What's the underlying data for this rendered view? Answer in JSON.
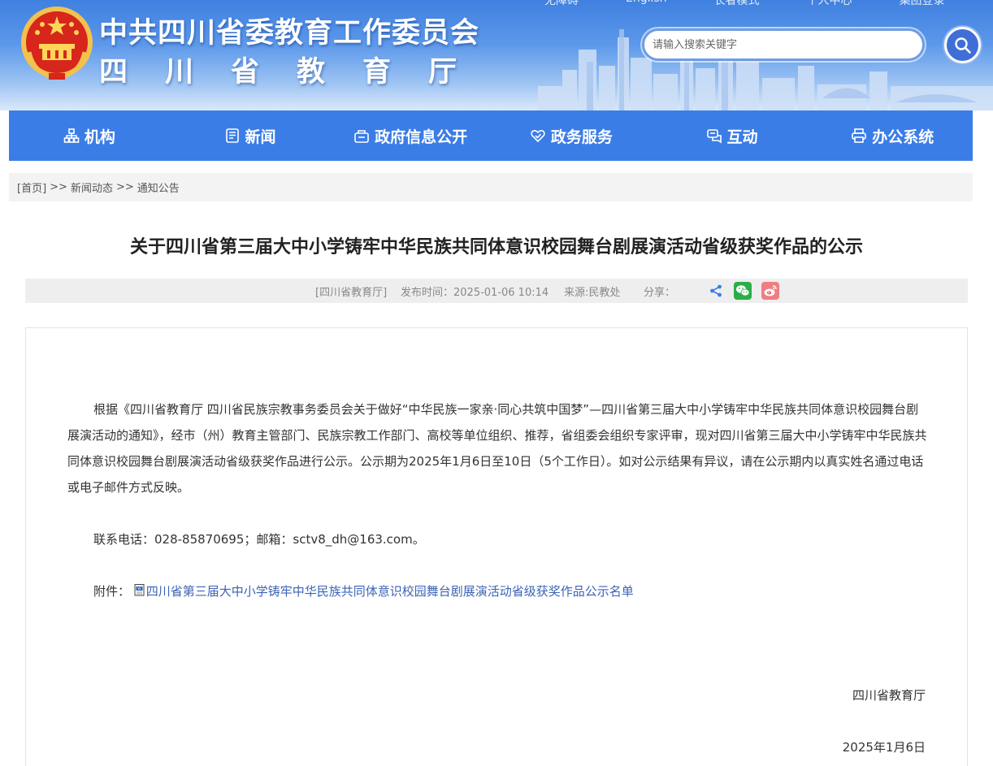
{
  "header": {
    "title_line1": "中共四川省委教育工作委员会",
    "title_line2": "四川省教育厅",
    "top_links": [
      "无障碍",
      "English",
      "长者模式",
      "个人中心",
      "集团登录"
    ],
    "search_placeholder": "请输入搜索关键字",
    "emblem_icon": "national-emblem-icon",
    "search_icon": "search-icon"
  },
  "nav": {
    "items": [
      {
        "label": "机构",
        "icon": "org-chart-icon"
      },
      {
        "label": "新闻",
        "icon": "news-icon"
      },
      {
        "label": "政府信息公开",
        "icon": "info-public-icon"
      },
      {
        "label": "政务服务",
        "icon": "heart-service-icon"
      },
      {
        "label": "互动",
        "icon": "chat-icon"
      },
      {
        "label": "办公系统",
        "icon": "printer-icon"
      }
    ]
  },
  "breadcrumb": {
    "home": "[首页]",
    "sep1": ">>",
    "level1": "新闻动态",
    "sep2": ">>",
    "level2": "通知公告"
  },
  "article": {
    "title": "关于四川省第三届大中小学铸牢中华民族共同体意识校园舞台剧展演活动省级获奖作品的公示",
    "meta": {
      "source_tag": "[四川省教育厅]",
      "publish_time": "发布时间：2025-01-06 10:14",
      "origin": "来源:民教处",
      "share_label": "分享："
    },
    "share_icons": [
      "share-icon",
      "wechat-icon",
      "weibo-icon"
    ],
    "body_paragraph": "根据《四川省教育厅 四川省民族宗教事务委员会关于做好“中华民族一家亲·同心共筑中国梦”—四川省第三届大中小学铸牢中华民族共同体意识校园舞台剧展演活动的通知》，经市（州）教育主管部门、民族宗教工作部门、高校等单位组织、推荐，省组委会组织专家评审，现对四川省第三届大中小学铸牢中华民族共同体意识校园舞台剧展演活动省级获奖作品进行公示。公示期为2025年1月6日至10日（5个工作日）。如对公示结果有异议，请在公示期内以真实姓名通过电话或电子邮件方式反映。",
    "contact": "联系电话：028-85870695；邮箱：sctv8_dh@163.com。",
    "attachment_label": "附件：",
    "attachment_link": "四川省第三届大中小学铸牢中华民族共同体意识校园舞台剧展演活动省级获奖作品公示名单",
    "signature": "四川省教育厅",
    "date": "2025年1月6日"
  },
  "colors": {
    "nav_bg": "#3b7de6",
    "header_top": "#3f80e0",
    "link": "#3b64b4",
    "wechat": "#2aae4a",
    "weibo": "#e8545e"
  }
}
